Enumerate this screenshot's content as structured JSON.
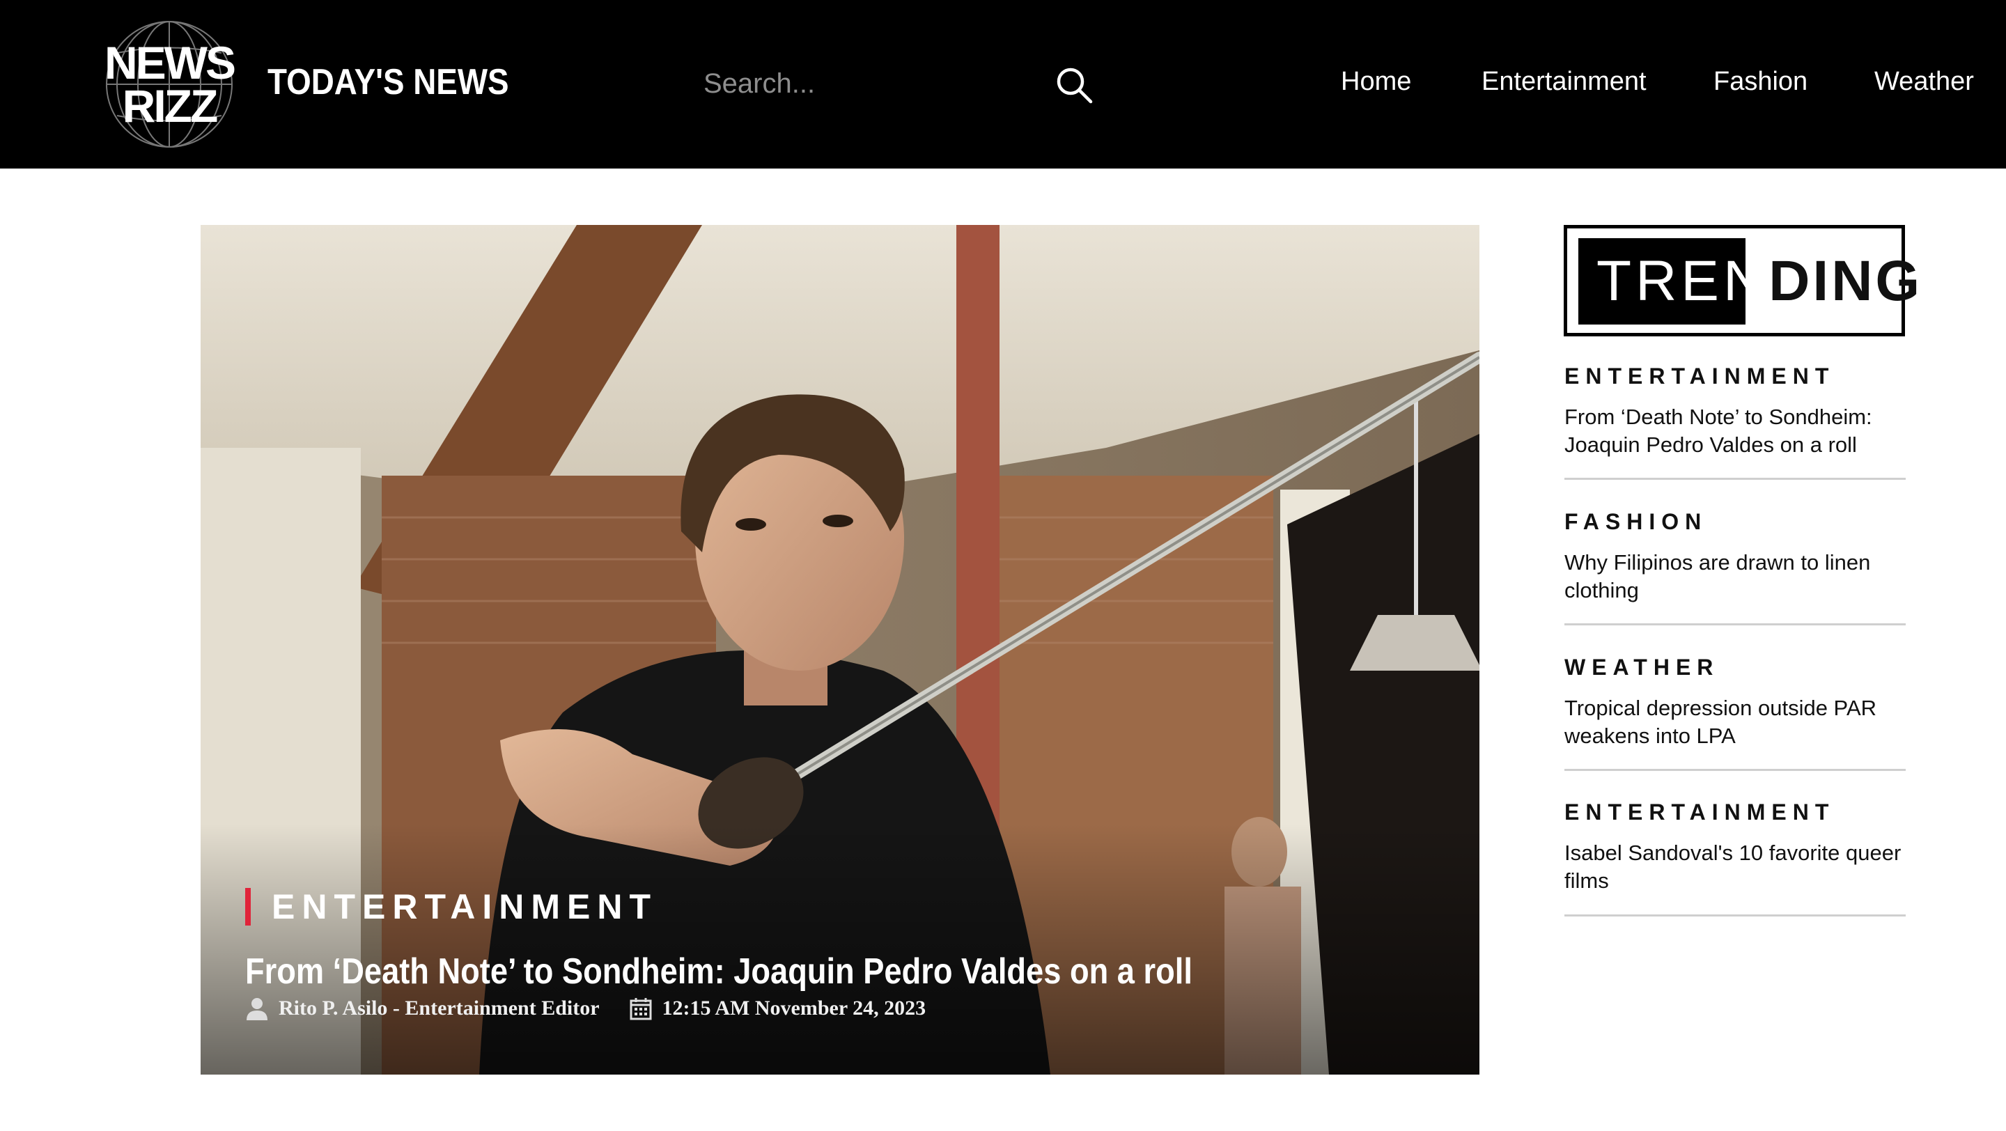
{
  "header": {
    "logo_line1": "NEWS",
    "logo_line2": "RIZZ",
    "site_title": "TODAY'S NEWS",
    "search_placeholder": "Search...",
    "nav": [
      "Home",
      "Entertainment",
      "Fashion",
      "Weather"
    ]
  },
  "hero": {
    "category": "ENTERTAINMENT",
    "title": "From ‘Death Note’ to Sondheim: Joaquin Pedro Valdes on a roll",
    "author": "Rito P. Asilo - Entertainment Editor",
    "datetime": "12:15 AM November 24, 2023"
  },
  "trending": {
    "heading_part1": "TREN",
    "heading_part2": "DING",
    "items": [
      {
        "category": "ENTERTAINMENT",
        "title": "From ‘Death Note’ to Sondheim: Joaquin Pedro Valdes on a roll"
      },
      {
        "category": "FASHION",
        "title": "Why Filipinos are drawn to linen clothing"
      },
      {
        "category": "WEATHER",
        "title": "Tropical depression outside PAR weakens into LPA"
      },
      {
        "category": "ENTERTAINMENT",
        "title": "Isabel Sandoval's 10 favorite queer films"
      }
    ]
  },
  "colors": {
    "header_bg": "#000000",
    "accent": "#e0243a",
    "divider": "#cfcfcf"
  }
}
